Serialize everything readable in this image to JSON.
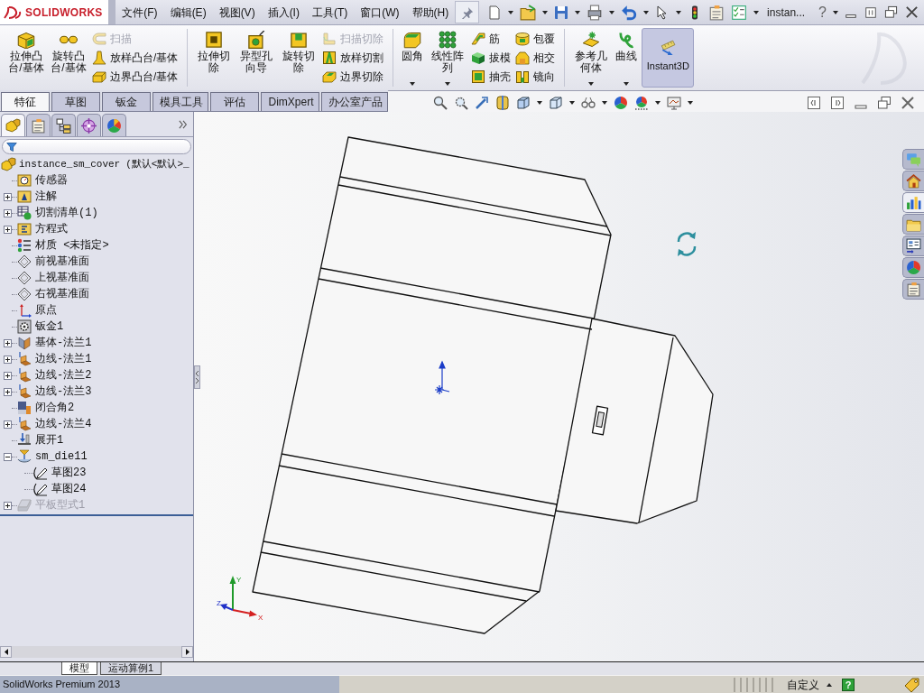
{
  "title_bar": {
    "logo_text": "SOLIDWORKS",
    "menu": [
      "文件(F)",
      "编辑(E)",
      "视图(V)",
      "插入(I)",
      "工具(T)",
      "窗口(W)",
      "帮助(H)"
    ],
    "document": "instan...",
    "help": "?"
  },
  "command_manager": {
    "groups": [
      [
        {
          "kind": "large",
          "label": "拉伸凸台/基体",
          "dropdown": false
        },
        {
          "kind": "large",
          "label": "旋转凸台/基体",
          "dropdown": false
        },
        {
          "kind": "stack",
          "items": [
            {
              "label": "扫描",
              "disabled": true
            },
            {
              "label": "放样凸台/基体",
              "disabled": false
            },
            {
              "label": "边界凸台/基体",
              "disabled": false
            }
          ]
        }
      ],
      [
        {
          "kind": "large",
          "label": "拉伸切除",
          "dropdown": false
        },
        {
          "kind": "large",
          "label": "异型孔向导",
          "dropdown": false
        },
        {
          "kind": "large",
          "label": "旋转切除",
          "dropdown": false
        },
        {
          "kind": "stack",
          "items": [
            {
              "label": "扫描切除",
              "disabled": true
            },
            {
              "label": "放样切割",
              "disabled": false
            },
            {
              "label": "边界切除",
              "disabled": false
            }
          ]
        }
      ],
      [
        {
          "kind": "large",
          "label": "圆角",
          "dropdown": true
        },
        {
          "kind": "large",
          "label": "线性阵列",
          "dropdown": true
        },
        {
          "kind": "stack",
          "items": [
            {
              "label": "筋",
              "disabled": false
            },
            {
              "label": "拔模",
              "disabled": false
            },
            {
              "label": "抽壳",
              "disabled": false
            }
          ]
        },
        {
          "kind": "stack",
          "items": [
            {
              "label": "包覆",
              "disabled": false
            },
            {
              "label": "相交",
              "disabled": false
            },
            {
              "label": "镜向",
              "disabled": false
            }
          ]
        }
      ],
      [
        {
          "kind": "large",
          "label": "参考几何体",
          "dropdown": true
        },
        {
          "kind": "large",
          "label": "曲线",
          "dropdown": true
        }
      ]
    ],
    "instant3d": {
      "label": "Instant3D",
      "on": true
    }
  },
  "tabs": [
    {
      "label": "特征",
      "selected": true
    },
    {
      "label": "草图",
      "selected": false
    },
    {
      "label": "钣金",
      "selected": false
    },
    {
      "label": "模具工具",
      "selected": false
    },
    {
      "label": "评估",
      "selected": false
    },
    {
      "label": "DimXpert",
      "selected": false
    },
    {
      "label": "办公室产品",
      "selected": false
    }
  ],
  "feature_manager": {
    "tabs": [
      {
        "selected": true
      },
      {
        "selected": false
      },
      {
        "selected": false
      },
      {
        "selected": false
      },
      {
        "selected": false
      }
    ],
    "root": {
      "label": "instance_sm_cover",
      "configuration": "(默认<默认>_"
    },
    "items": [
      {
        "kind": "sensor",
        "label": "传感器",
        "disabled": false
      },
      {
        "kind": "annotation",
        "label": "注解",
        "expanded": false,
        "disabled": false
      },
      {
        "kind": "cutlist",
        "label": "切割清单(1)",
        "expanded": false,
        "disabled": false
      },
      {
        "kind": "equation",
        "label": "方程式",
        "expanded": false,
        "disabled": false
      },
      {
        "kind": "material",
        "label": "材质 <未指定>",
        "disabled": false
      },
      {
        "kind": "plane",
        "label": "前视基准面",
        "disabled": false
      },
      {
        "kind": "plane",
        "label": "上视基准面",
        "disabled": false
      },
      {
        "kind": "plane",
        "label": "右视基准面",
        "disabled": false
      },
      {
        "kind": "origin",
        "label": "原点",
        "disabled": false
      },
      {
        "kind": "sheetmetal",
        "label": "钣金1",
        "disabled": false
      },
      {
        "kind": "baseflange",
        "label": "基体-法兰1",
        "expanded": false,
        "disabled": false
      },
      {
        "kind": "edgeflange",
        "label": "边线-法兰1",
        "expanded": false,
        "disabled": false
      },
      {
        "kind": "edgeflange",
        "label": "边线-法兰2",
        "expanded": false,
        "disabled": false
      },
      {
        "kind": "edgeflange",
        "label": "边线-法兰3",
        "expanded": false,
        "disabled": false
      },
      {
        "kind": "corner",
        "label": "闭合角2",
        "disabled": false
      },
      {
        "kind": "edgeflange",
        "label": "边线-法兰4",
        "expanded": false,
        "disabled": false
      },
      {
        "kind": "unfold",
        "label": "展开1",
        "disabled": false
      },
      {
        "kind": "library",
        "label": "sm_die11",
        "expanded": true,
        "disabled": false,
        "children": [
          {
            "kind": "sketch",
            "label": "草图23",
            "disabled": false
          },
          {
            "kind": "sketch",
            "label": "草图24",
            "disabled": false
          }
        ]
      },
      {
        "kind": "flatpattern",
        "label": "平板型式1",
        "expanded": false,
        "disabled": true
      }
    ]
  },
  "viewport": {
    "triad": {
      "x": "X",
      "y": "Y",
      "z": "Z"
    }
  },
  "task_pane": [
    {
      "selected": false
    },
    {
      "selected": false
    },
    {
      "selected": true
    },
    {
      "selected": false
    },
    {
      "selected": false
    },
    {
      "selected": false
    },
    {
      "selected": false
    }
  ],
  "bottom_tabs": [
    {
      "label": "模型",
      "selected": true
    },
    {
      "label": "运动算例1",
      "selected": false
    }
  ],
  "status_bar": {
    "product": "SolidWorks Premium 2013",
    "units": "自定义",
    "help": "?"
  }
}
